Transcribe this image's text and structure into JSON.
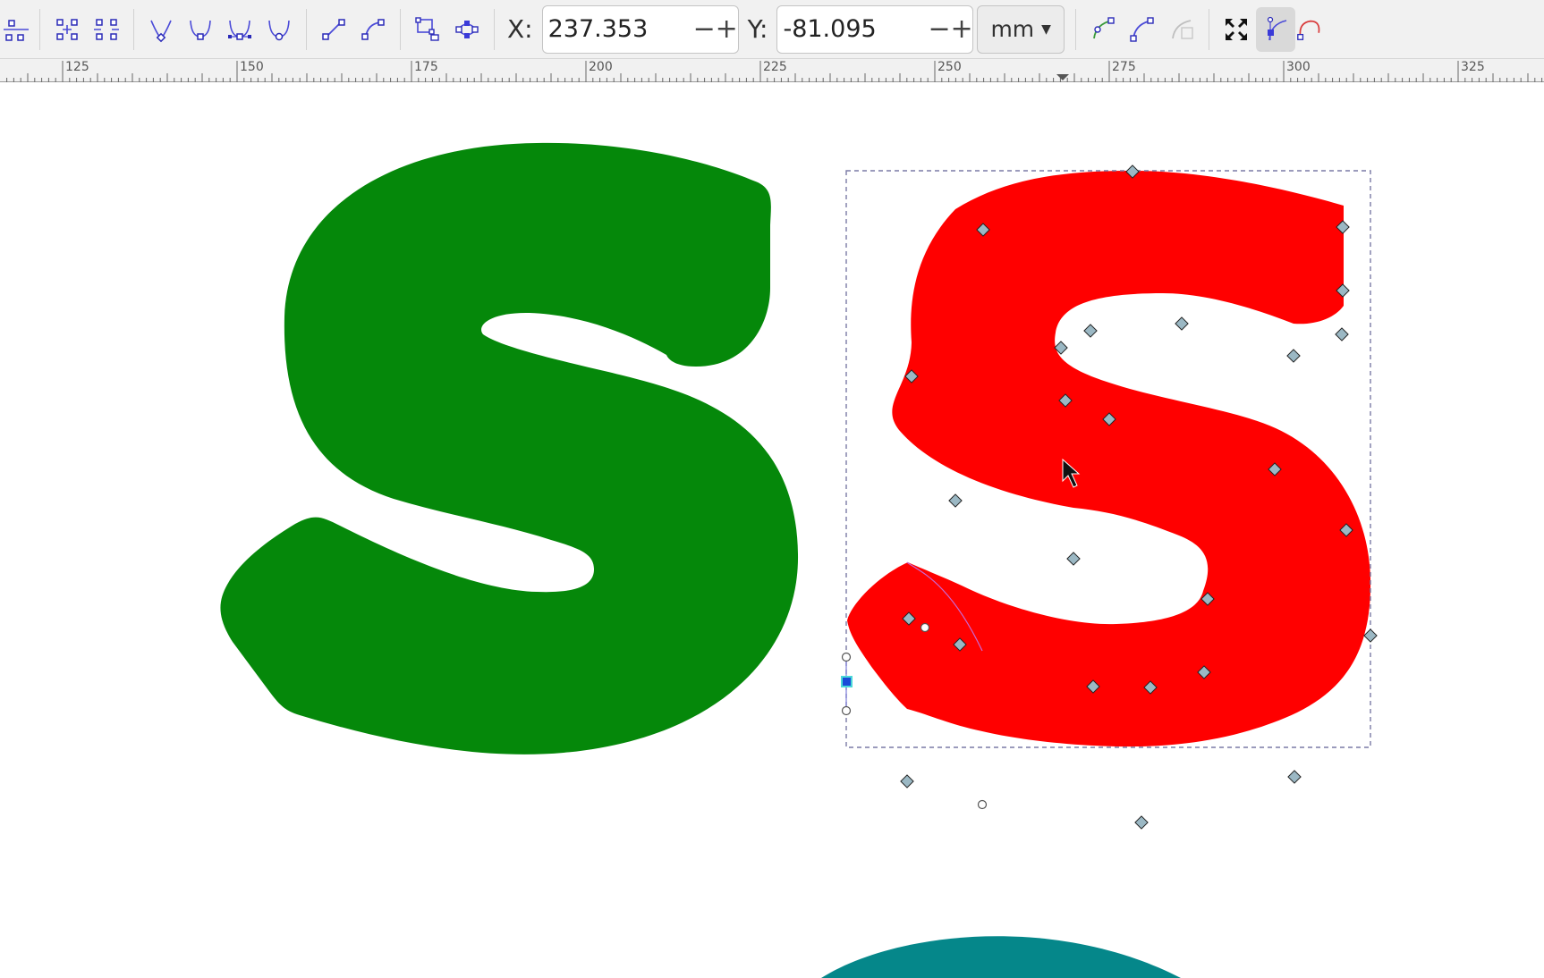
{
  "toolbar": {
    "x_label": "X:",
    "x_value": "237.353",
    "y_label": "Y:",
    "y_value": "-81.095",
    "minus": "−",
    "plus": "+",
    "unit": "mm"
  },
  "ruler": {
    "labels": [
      "125",
      "150",
      "175",
      "200",
      "225",
      "250",
      "275",
      "300",
      "325"
    ]
  },
  "canvas": {
    "colors": {
      "green_s": "#05880a",
      "red_s": "#ff0000",
      "teal_shape": "#05878a",
      "node_handle": "#9bb8c4",
      "bbox_dash": "#7a7aa5"
    }
  },
  "icons": {
    "insert_node": "insert-node-icon",
    "join_nodes": "join-nodes-icon",
    "break_path": "break-path-icon",
    "cusp": "node-cusp-icon",
    "smooth": "node-smooth-icon",
    "symmetric": "node-symmetric-icon",
    "auto_smooth": "node-auto-smooth-icon",
    "segment_line": "segment-line-icon",
    "segment_curve": "segment-curve-icon",
    "object_to_path": "object-to-path-icon",
    "stroke_to_path": "stroke-to-path-icon"
  }
}
